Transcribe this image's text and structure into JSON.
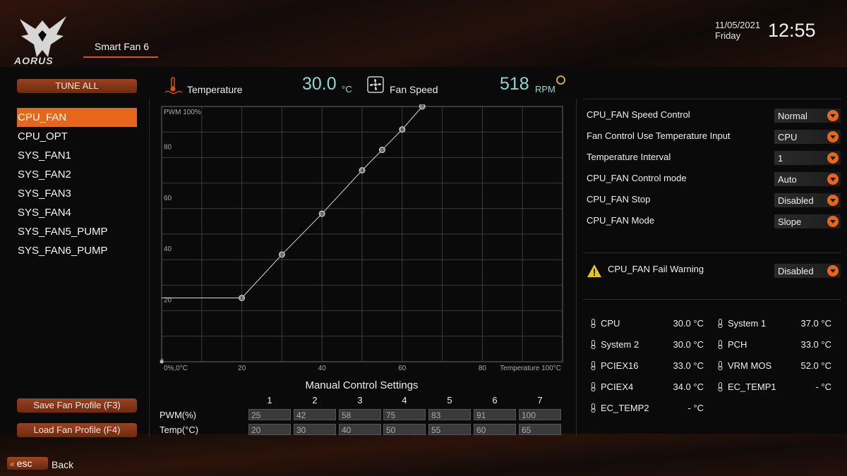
{
  "header": {
    "logo_text": "AORUS",
    "page_tab": "Smart Fan 6",
    "date": "11/05/2021",
    "day": "Friday",
    "time": "12:55"
  },
  "left": {
    "tune_all": "TUNE ALL",
    "fans": [
      "CPU_FAN",
      "CPU_OPT",
      "SYS_FAN1",
      "SYS_FAN2",
      "SYS_FAN3",
      "SYS_FAN4",
      "SYS_FAN5_PUMP",
      "SYS_FAN6_PUMP"
    ],
    "selected_fan": "CPU_FAN",
    "save_profile": "Save Fan Profile (F3)",
    "load_profile": "Load Fan Profile (F4)",
    "esc_label": "esc",
    "back_label": "Back"
  },
  "readout": {
    "temperature_label": "Temperature",
    "temperature_value": "30.0",
    "temperature_unit": "°C",
    "fan_speed_label": "Fan Speed",
    "fan_speed_value": "518",
    "fan_speed_unit": "RPM"
  },
  "chart_data": {
    "type": "line",
    "y_top_label": "PWM 100%",
    "x_origin_label": "0%,0°C",
    "x_end_label": "Temperature 100°C",
    "origin_tick": "0",
    "xticks": [
      "20",
      "40",
      "60",
      "80"
    ],
    "yticks": [
      "20",
      "40",
      "60",
      "80"
    ],
    "xlim": [
      0,
      100
    ],
    "ylim": [
      0,
      100
    ],
    "grid": true,
    "baseline_start": [
      0,
      25
    ],
    "points": [
      {
        "id": "1",
        "x": 20,
        "y": 25
      },
      {
        "id": "2",
        "x": 30,
        "y": 42
      },
      {
        "id": "3",
        "x": 40,
        "y": 58
      },
      {
        "id": "4",
        "x": 50,
        "y": 75
      },
      {
        "id": "5",
        "x": 55,
        "y": 83
      },
      {
        "id": "6",
        "x": 60,
        "y": 91
      },
      {
        "id": "7",
        "x": 65,
        "y": 100
      }
    ]
  },
  "manual": {
    "title": "Manual Control Settings",
    "columns": [
      "1",
      "2",
      "3",
      "4",
      "5",
      "6",
      "7"
    ],
    "pwm_label": "PWM(%)",
    "temp_label": "Temp(°C)",
    "pwm": [
      "25",
      "42",
      "58",
      "75",
      "83",
      "91",
      "100"
    ],
    "temp": [
      "20",
      "30",
      "40",
      "50",
      "55",
      "60",
      "65"
    ]
  },
  "settings": [
    {
      "label": "CPU_FAN Speed Control",
      "value": "Normal"
    },
    {
      "label": "Fan Control Use Temperature Input",
      "value": "CPU"
    },
    {
      "label": "Temperature Interval",
      "value": "1"
    },
    {
      "label": "CPU_FAN Control mode",
      "value": "Auto"
    },
    {
      "label": "CPU_FAN Stop",
      "value": "Disabled"
    },
    {
      "label": "CPU_FAN Mode",
      "value": "Slope"
    }
  ],
  "fail_warning": {
    "label": "CPU_FAN Fail Warning",
    "value": "Disabled"
  },
  "sensors": [
    {
      "name": "CPU",
      "value": "30.0 °C"
    },
    {
      "name": "System 1",
      "value": "37.0 °C"
    },
    {
      "name": "System 2",
      "value": "30.0 °C"
    },
    {
      "name": "PCH",
      "value": "33.0 °C"
    },
    {
      "name": "PCIEX16",
      "value": "33.0 °C"
    },
    {
      "name": "VRM MOS",
      "value": "52.0 °C"
    },
    {
      "name": "PCIEX4",
      "value": "34.0 °C"
    },
    {
      "name": "EC_TEMP1",
      "value": "- °C"
    },
    {
      "name": "EC_TEMP2",
      "value": "- °C"
    }
  ],
  "colors": {
    "accent": "#e8661c",
    "value_cyan": "#8fd6cf",
    "button_dark_orange": "#8a3a1a"
  }
}
